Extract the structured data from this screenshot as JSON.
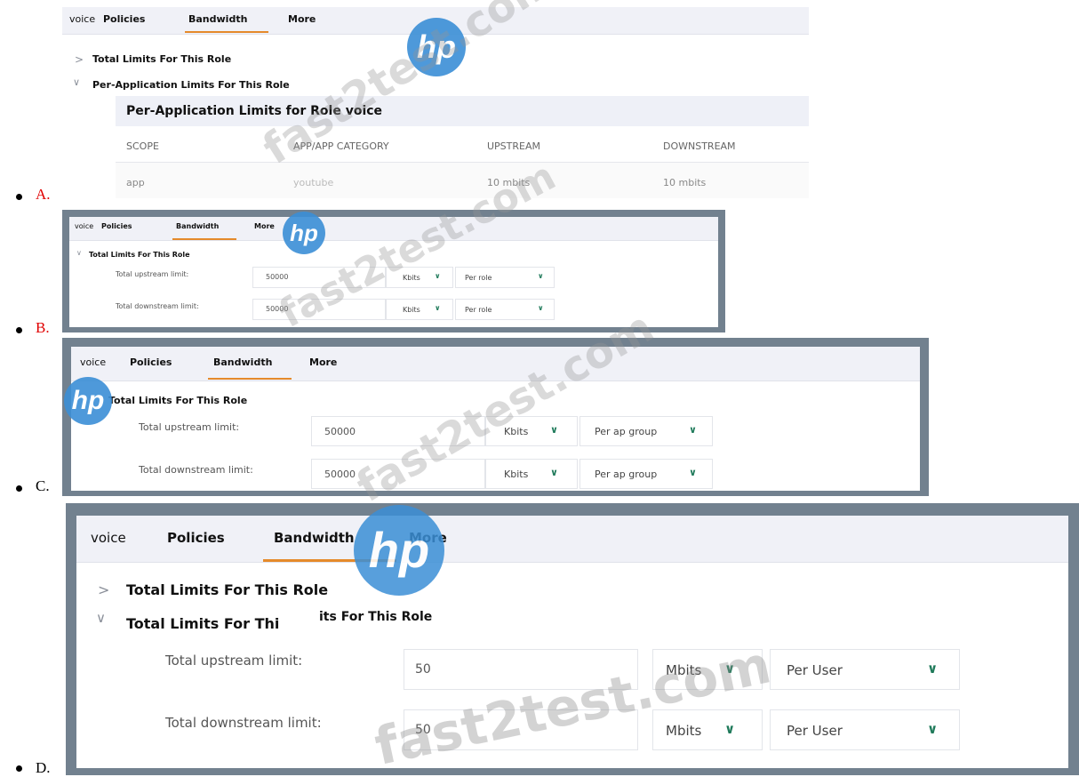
{
  "options": [
    {
      "letter": "A.",
      "color": "#e00000"
    },
    {
      "letter": "B.",
      "color": "#e00000"
    },
    {
      "letter": "C.",
      "color": "#000000"
    },
    {
      "letter": "D.",
      "color": "#000000"
    }
  ],
  "tabs": {
    "voice": "voice",
    "policies": "Policies",
    "bandwidth": "Bandwidth",
    "more": "More"
  },
  "a": {
    "total_section": "Total Limits For This Role",
    "perapp_section": "Per-Application Limits For This Role",
    "table_title": "Per-Application Limits for Role voice",
    "columns": [
      "SCOPE",
      "APP/APP CATEGORY",
      "UPSTREAM",
      "DOWNSTREAM"
    ],
    "row": [
      "app",
      "youtube",
      "10 mbits",
      "10 mbits"
    ]
  },
  "b": {
    "section": "Total Limits For This Role",
    "up_label": "Total upstream limit:",
    "down_label": "Total downstream limit:",
    "up_value": "50000",
    "down_value": "50000",
    "unit": "Kbits",
    "scope": "Per role"
  },
  "c": {
    "section": "Total Limits For This Role",
    "up_label": "Total upstream limit:",
    "down_label": "Total downstream limit:",
    "up_value": "50000",
    "down_value": "50000",
    "unit": "Kbits",
    "scope": "Per ap group"
  },
  "d": {
    "section1": "Total Limits For This Role",
    "section2": "Total Limits For Thi",
    "section2_overlap": "its For This Role",
    "up_label": "Total upstream limit:",
    "down_label": "Total downstream limit:",
    "up_value": "50",
    "down_value": "50",
    "unit": "Mbits",
    "scope": "Per User"
  },
  "watermark": {
    "text": "fast2test.com",
    "logo": "hp",
    "logo_color": "#3b8fd6"
  },
  "icons": {
    "expand": "chevron-right-icon",
    "collapse": "chevron-down-icon",
    "dropdown": "chevron-down-icon"
  }
}
